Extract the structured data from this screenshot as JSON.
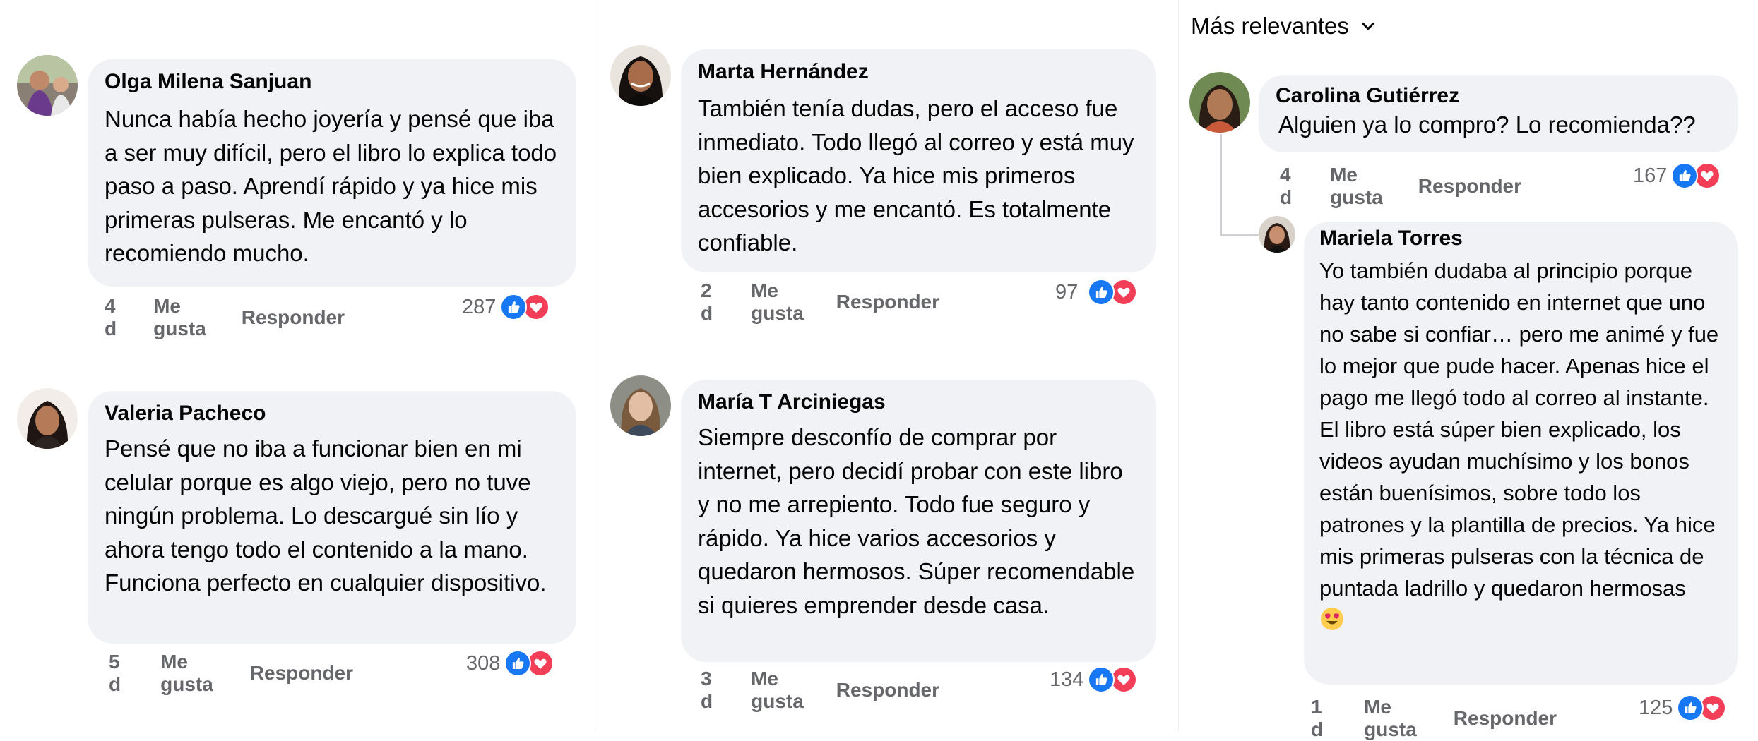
{
  "sort": {
    "label": "Más relevantes",
    "icon": "chevron-down-icon"
  },
  "comments": [
    {
      "author": "Olga Milena Sanjuan",
      "text": "Nunca había hecho joyería y pensé que iba a ser muy difícil, pero el libro lo explica todo paso a paso. Aprendí rápido y ya hice mis primeras pulseras. Me encantó y lo recomiendo mucho.",
      "time": "4 d",
      "like": "Me gusta",
      "reply": "Responder",
      "reactions": "287"
    },
    {
      "author": "Valeria Pacheco",
      "text": "Pensé que no iba a funcionar bien en mi celular porque es algo viejo, pero no tuve ningún problema. Lo descargué sin lío y ahora tengo todo el contenido a la mano. Funciona perfecto en cualquier dispositivo.",
      "time": "5 d",
      "like": "Me gusta",
      "reply": "Responder",
      "reactions": "308"
    },
    {
      "author": "Marta Hernández",
      "text": "También tenía dudas, pero el acceso fue inmediato. Todo llegó al correo y está muy bien explicado. Ya hice mis primeros accesorios y me encantó. Es totalmente confiable.",
      "time": "2 d",
      "like": "Me gusta",
      "reply": "Responder",
      "reactions": "97"
    },
    {
      "author": "María T Arciniegas",
      "text": "Siempre desconfío de comprar por internet, pero decidí probar con este libro y no me arrepiento. Todo fue seguro y rápido. Ya hice varios accesorios y quedaron hermosos. Súper recomendable si quieres emprender desde casa.",
      "time": "3 d",
      "like": "Me gusta",
      "reply": "Responder",
      "reactions": "134"
    },
    {
      "author": "Carolina Gutiérrez",
      "text": "Alguien ya lo compro? Lo recomienda??",
      "time": "4 d",
      "like": "Me gusta",
      "reply": "Responder",
      "reactions": "167"
    },
    {
      "author": "Mariela Torres",
      "text": "Yo también dudaba al principio porque hay tanto contenido en internet que uno no sabe si confiar… pero me animé y fue lo mejor que pude hacer. Apenas hice el pago me llegó todo al correo al instante. El libro está súper bien explicado, los videos ayudan muchísimo y los bonos están buenísimos, sobre todo los patrones y la plantilla de precios. Ya hice mis primeras pulseras con la técnica de puntada ladrillo y quedaron hermosas",
      "emoji": "heart-eyes-emoji",
      "time": "1 d",
      "like": "Me gusta",
      "reply": "Responder",
      "reactions": "125"
    }
  ],
  "colors": {
    "like": "#1877f2",
    "love": "#f33e58",
    "bubble": "#f0f2f5",
    "meta": "#65676b"
  }
}
